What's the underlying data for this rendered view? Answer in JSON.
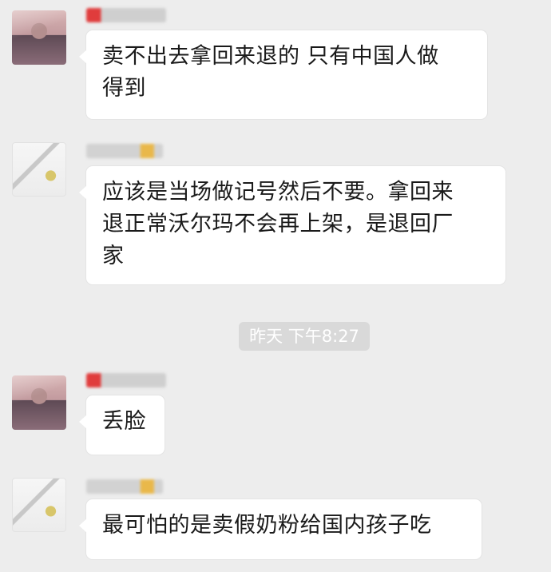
{
  "chat": {
    "messages": [
      {
        "text": "卖不出去拿回来退的 只有中国人做得到",
        "lines": [
          "卖不出去拿回来退的 只有中国人做",
          "得到"
        ]
      },
      {
        "text": "应该是当场做记号然后不要。拿回来退正常沃尔玛不会再上架，是退回厂家",
        "lines": [
          "应该是当场做记号然后不要。拿回来",
          "退正常沃尔玛不会再上架，是退回厂",
          "家"
        ]
      },
      {
        "text": "丢脸",
        "lines": [
          "丢脸"
        ]
      },
      {
        "text": "最可怕的是卖假奶粉给国内孩子吃",
        "lines": [
          "最可怕的是卖假奶粉给国内孩子吃"
        ]
      }
    ],
    "timestamp": "昨天 下午8:27"
  },
  "colors": {
    "background": "#ededed",
    "bubble": "#ffffff",
    "timestamp_badge": "#d9d9d9"
  }
}
